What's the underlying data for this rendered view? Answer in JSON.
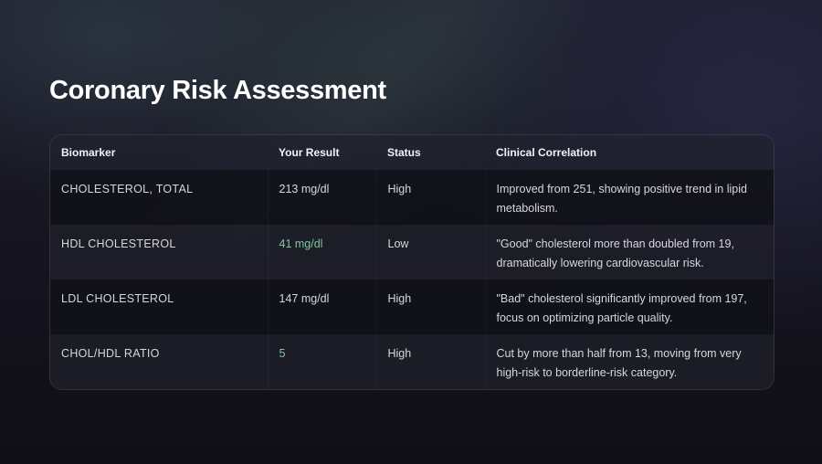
{
  "title": "Coronary Risk Assessment",
  "table": {
    "headers": [
      "Biomarker",
      "Your Result",
      "Status",
      "Clinical Correlation"
    ],
    "rows": [
      {
        "biomarker": "CHOLESTEROL, TOTAL",
        "result": "213 mg/dl",
        "status": "High",
        "correlation": "Improved from 251, showing positive trend in lipid metabolism."
      },
      {
        "biomarker": "HDL CHOLESTEROL",
        "result": "41 mg/dl",
        "status": "Low",
        "correlation": "\"Good\" cholesterol more than doubled from 19, dramatically lowering cardiovascular risk."
      },
      {
        "biomarker": "LDL CHOLESTEROL",
        "result": "147 mg/dl",
        "status": "High",
        "correlation": "\"Bad\" cholesterol significantly improved from 197, focus on optimizing particle quality."
      },
      {
        "biomarker": "CHOL/HDL RATIO",
        "result": "5",
        "status": "High",
        "correlation": "Cut by more than half from 13, moving from very high-risk to borderline-risk category."
      }
    ]
  },
  "colors": {
    "improved_result": "#7fc4a0",
    "title": "#ffffff"
  }
}
